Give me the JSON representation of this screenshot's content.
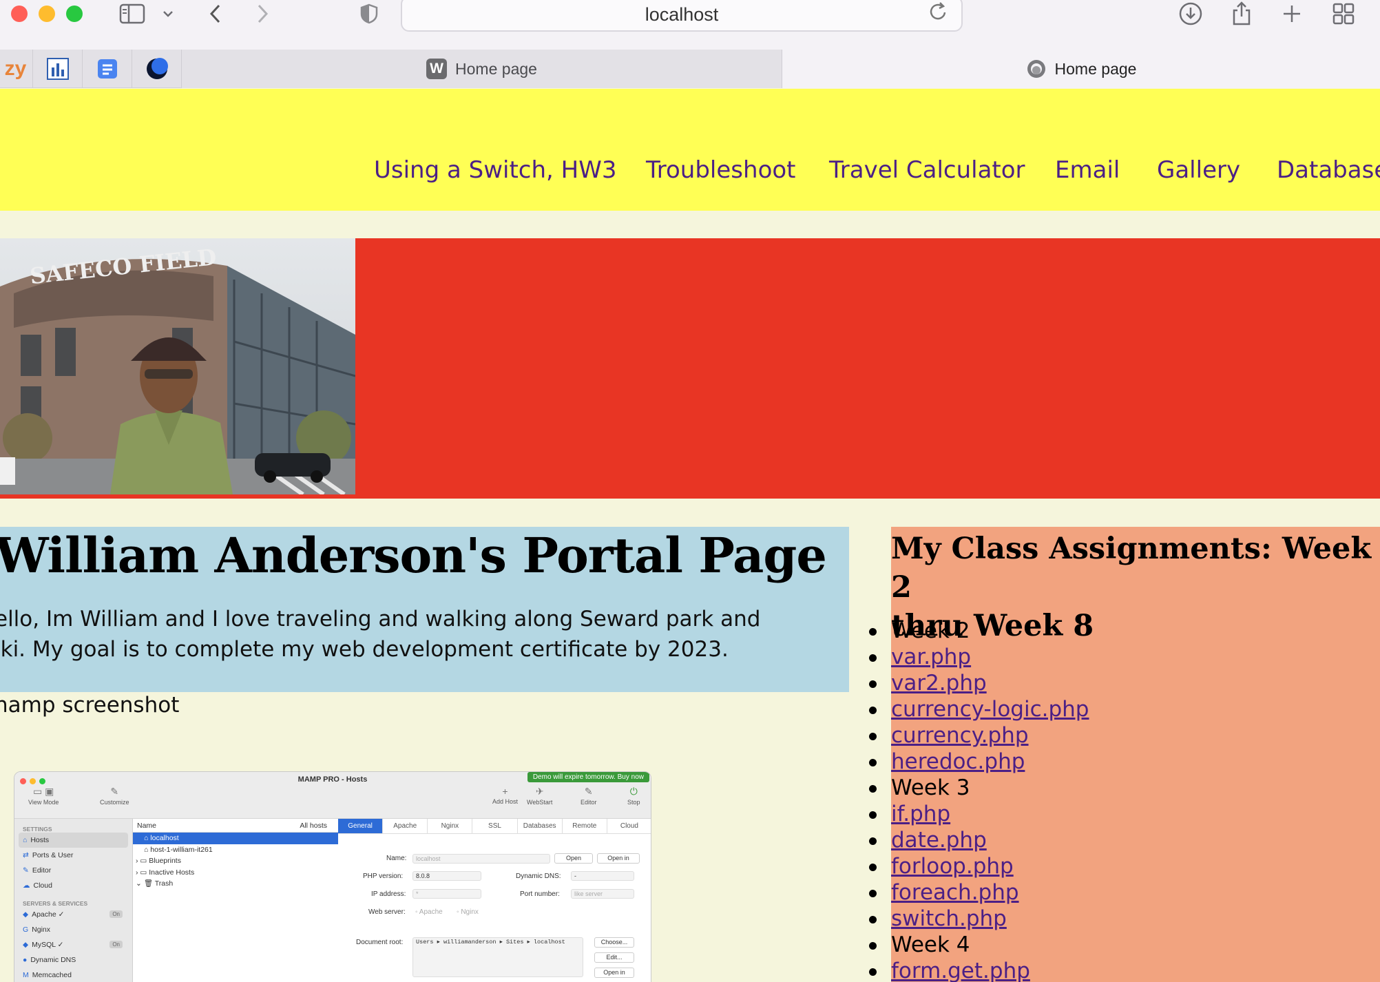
{
  "browser": {
    "url": "localhost",
    "tabs": [
      {
        "title": "Home page",
        "favicon_letter": "W",
        "active": false
      },
      {
        "title": "Home page",
        "active": true
      }
    ],
    "pinned_partial_text": "zy"
  },
  "nav": {
    "links": [
      "Using a Switch, HW3",
      "Troubleshoot",
      "Travel Calculator",
      "Email",
      "Gallery",
      "Database"
    ]
  },
  "intro": {
    "title": "William Anderson's Portal Page",
    "line1": "ello, Im William and I love traveling and walking along Seward park and",
    "line2": "lki. My goal is to complete my web development certificate by 2023.",
    "caption": "namp screenshot"
  },
  "assignments": {
    "heading_line1": "My Class Assignments: Week 2",
    "heading_line2": "thru Week 8",
    "items": [
      {
        "text": "Week 2",
        "link": false
      },
      {
        "text": "var.php",
        "link": true
      },
      {
        "text": "var2.php",
        "link": true
      },
      {
        "text": "currency-logic.php",
        "link": true
      },
      {
        "text": "currency.php",
        "link": true
      },
      {
        "text": "heredoc.php",
        "link": true
      },
      {
        "text": "Week 3",
        "link": false
      },
      {
        "text": "if.php",
        "link": true
      },
      {
        "text": "date.php",
        "link": true
      },
      {
        "text": "forloop.php",
        "link": true
      },
      {
        "text": "foreach.php",
        "link": true
      },
      {
        "text": "switch.php",
        "link": true
      },
      {
        "text": "Week 4",
        "link": false
      },
      {
        "text": "form.get.php",
        "link": true
      }
    ]
  },
  "hero": {
    "photo_sign": "SAFECO FIELD"
  },
  "mamp": {
    "title": "MAMP PRO - Hosts",
    "demo_banner": "Demo will expire tomorrow. Buy now",
    "toolbar": [
      "View Mode",
      "Customize",
      "Add Host",
      "WebStart",
      "Editor",
      "Stop"
    ],
    "settings_header": "SETTINGS",
    "settings": [
      "Hosts",
      "Ports & User",
      "Editor",
      "Cloud"
    ],
    "servers_header": "SERVERS & SERVICES",
    "servers": [
      {
        "name": "Apache ✓",
        "status": "On"
      },
      {
        "name": "Nginx",
        "status": ""
      },
      {
        "name": "MySQL ✓",
        "status": "On"
      },
      {
        "name": "Dynamic DNS",
        "status": ""
      },
      {
        "name": "Memcached",
        "status": ""
      }
    ],
    "list_header": "Name",
    "list_filter": "All hosts",
    "hosts": [
      "localhost",
      "host-1-william-it261",
      "Blueprints",
      "Inactive Hosts",
      "Trash"
    ],
    "tabs": [
      "General",
      "Apache",
      "Nginx",
      "SSL",
      "Databases",
      "Remote",
      "Cloud"
    ],
    "fields": {
      "name_label": "Name:",
      "name_value": "localhost",
      "php_label": "PHP version:",
      "php_value": "8.0.8",
      "dns_label": "Dynamic DNS:",
      "dns_value": "-",
      "ip_label": "IP address:",
      "ip_value": "*",
      "port_label": "Port number:",
      "port_value": "like server",
      "web_label": "Web server:",
      "web_apache": "Apache",
      "web_nginx": "Nginx",
      "docroot_label": "Document root:",
      "docroot_value": "Users ▸ williamanderson ▸ Sites ▸ localhost",
      "open": "Open",
      "open_in": "Open in",
      "choose": "Choose...",
      "edit": "Edit..."
    }
  },
  "colors": {
    "nav_bg": "#ffff55",
    "nav_link": "#4b1f86",
    "hero_bg": "#e83524",
    "intro_bg": "#b4d7e3",
    "assign_bg": "#f2a37f",
    "page_bg": "#f5f5dc"
  }
}
